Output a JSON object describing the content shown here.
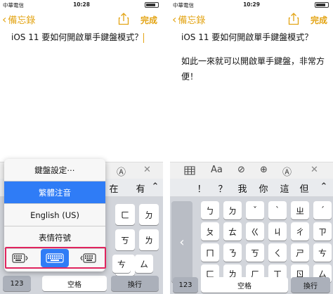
{
  "left": {
    "status": {
      "carrier": "中華電信",
      "time": "10:28"
    },
    "nav": {
      "back": "備忘錄",
      "done": "完成"
    },
    "note": {
      "line1": "iOS 11 要如何開啟單手鍵盤模式？"
    },
    "toolbar_tail": [
      "Ⓐ",
      "✕"
    ],
    "predict_tail": [
      "在",
      "有"
    ],
    "popup": {
      "items": [
        "鍵盤設定⋯",
        "繁體注音",
        "English (US)",
        "表情符號"
      ],
      "selected": 1
    },
    "keys_visible": [
      "ㄈ",
      "ㄉ",
      "ㄎ",
      "ㄌ",
      "ㄏ",
      "ㄘ",
      "ㄙ",
      "ㄠ",
      "ㄡ"
    ],
    "bottom": {
      "num": "123",
      "space": "空格",
      "return": "換行"
    }
  },
  "right": {
    "status": {
      "carrier": "中華電信",
      "time": "10:29"
    },
    "nav": {
      "back": "備忘錄",
      "done": "完成"
    },
    "note": {
      "line1": "iOS 11 要如何開啟單手鍵盤模式？",
      "line2": "如此一來就可以開啟單手鍵盤，非常方便！"
    },
    "toolbar_aa": "Aa",
    "predict": [
      "！",
      "？",
      "我",
      "你",
      "這",
      "但"
    ],
    "rows": [
      [
        "ㄅ",
        "ㄉ",
        "ˇ",
        "ˋ",
        "ㄓ",
        "ˊ"
      ],
      [
        "ㄆ",
        "ㄊ",
        "ㄍ",
        "ㄐ",
        "ㄔ",
        "ㄗ"
      ],
      [
        "ㄇ",
        "ㄋ",
        "ㄎ",
        "ㄑ",
        "ㄕ",
        "ㄘ"
      ],
      [
        "ㄈ",
        "ㄌ",
        "ㄏ",
        "ㄒ",
        "ㄖ",
        "ㄙ"
      ]
    ],
    "bottom": {
      "num": "123",
      "space": "空格",
      "return": "換行"
    }
  },
  "colors": {
    "accent": "#e3a414",
    "selected": "#2f7cf6",
    "highlight": "#e0245e"
  }
}
